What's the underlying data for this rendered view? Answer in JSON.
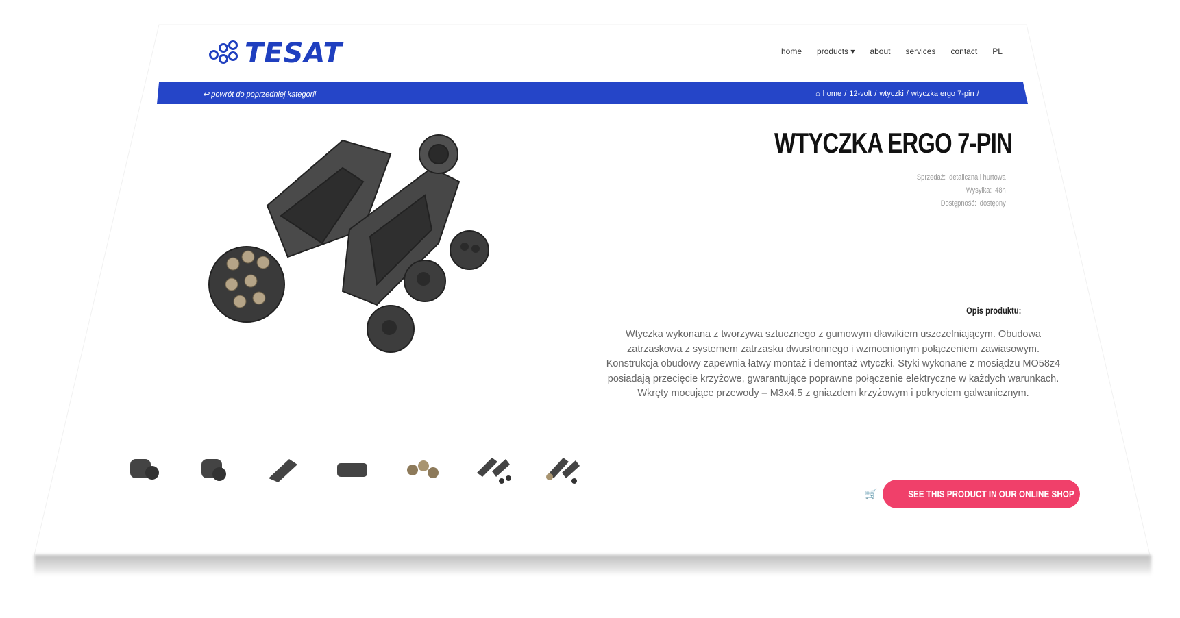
{
  "brand": {
    "name": "TESAT",
    "color": "#1f3fbf"
  },
  "nav": {
    "items": [
      "home",
      "products",
      "about",
      "services",
      "contact",
      "PL"
    ],
    "dropdown_icon": "chevron-down-icon"
  },
  "breadcrumb_bar": {
    "color": "#2545c8",
    "back_label": "powrót do poprzedniej kategorii",
    "crumbs": [
      "home",
      "12-volt",
      "wtyczki",
      "wtyczka ergo 7-pin"
    ]
  },
  "product": {
    "title": "WTYCZKA ERGO 7-PIN",
    "meta": [
      {
        "label": "Sprzedaż:",
        "value": "detaliczna i hurtowa"
      },
      {
        "label": "Wysyłka:",
        "value": "48h"
      },
      {
        "label": "Dostępność:",
        "value": "dostępny"
      }
    ],
    "description_heading": "Opis produktu:",
    "description": "Wtyczka wykonana z tworzywa sztucznego z gumowym dławikiem uszczelniającym. Obudowa zatrzaskowa z systemem zatrzasku dwustronnego i wzmocnionym połączeniem zawiasowym. Konstrukcja obudowy zapewnia łatwy montaż i demontaż wtyczki. Styki wykonane z mosiądzu MO58z4 posiadają przecięcie krzyżowe, gwarantujące poprawne połączenie elektryczne w każdych warunkach. Wkręty mocujące przewody – M3x4,5 z gniazdem krzyżowym i pokryciem galwanicznym."
  },
  "cta": {
    "label": "SEE THIS PRODUCT IN OUR ONLINE SHOP",
    "color": "#f0406a",
    "icon": "cart-icon"
  }
}
